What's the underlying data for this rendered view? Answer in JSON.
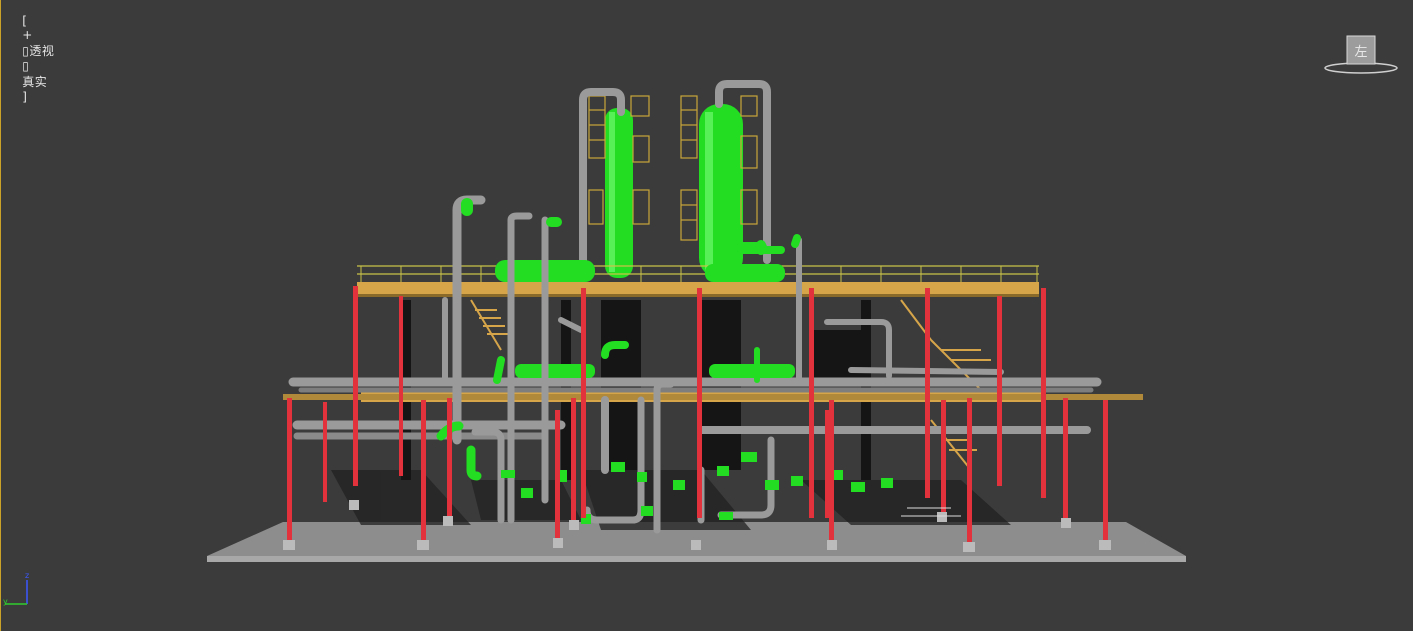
{
  "viewport": {
    "label": {
      "open": "[",
      "plus": "+",
      "sep1": "▯",
      "view_mode": "透视",
      "sep2": "▯",
      "shading": "真实",
      "close": "]"
    },
    "viewcube": {
      "face_label": "左"
    },
    "axis": {
      "z": "z",
      "y": "y"
    }
  },
  "colors": {
    "background": "#3b3b3b",
    "ground": "#8c8c8c",
    "steel_column": "#e2333c",
    "platform": "#d6a54a",
    "railing": "#c8c24a",
    "vessel": "#22dd22",
    "pipe": "#9a9a9a",
    "shadow": "#1c1c1c"
  }
}
